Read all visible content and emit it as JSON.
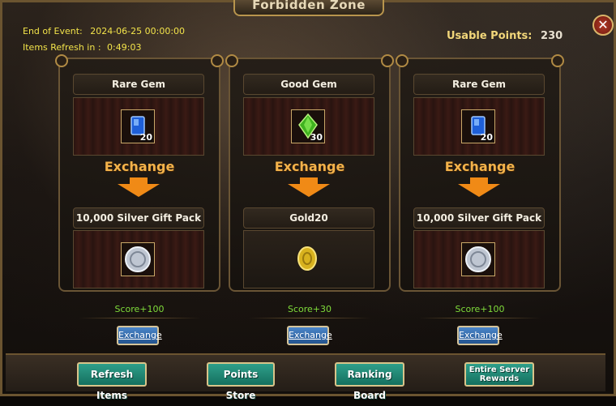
{
  "title": "Forbidden Zone",
  "close_label": "✕",
  "event": {
    "end_label": "End of Event:",
    "end_value": "2024-06-25 00:00:00",
    "refresh_label": "Items Refresh in :",
    "refresh_value": "0:49:03"
  },
  "usable_points": {
    "label": "Usable Points:",
    "value": "230"
  },
  "exchange_word": "Exchange",
  "exchanges": [
    {
      "give_name": "Rare Gem",
      "give_qty": "20",
      "give_icon": "blue-gem-icon",
      "get_name": "10,000 Silver Gift Pack",
      "get_icon": "silver-coin-icon",
      "score": "Score+100",
      "button": "Exchange"
    },
    {
      "give_name": "Good Gem",
      "give_qty": "30",
      "give_icon": "green-gem-icon",
      "get_name": "Gold20",
      "get_icon": "gold-coin-icon",
      "score": "Score+30",
      "button": "Exchange"
    },
    {
      "give_name": "Rare Gem",
      "give_qty": "20",
      "give_icon": "blue-gem-icon",
      "get_name": "10,000 Silver Gift Pack",
      "get_icon": "silver-coin-icon",
      "score": "Score+100",
      "button": "Exchange"
    }
  ],
  "bottom_buttons": {
    "refresh": "Refresh Items",
    "store": "Points Store",
    "ranking": "Ranking Board",
    "rewards_line1": "Entire Server",
    "rewards_line2": "Rewards"
  },
  "colors": {
    "accent_gold": "#f3b24a",
    "score_green": "#7fdc3a",
    "info_yellow": "#f2e34a",
    "button_teal": "#1f8a76",
    "button_blue": "#2f6aae"
  }
}
